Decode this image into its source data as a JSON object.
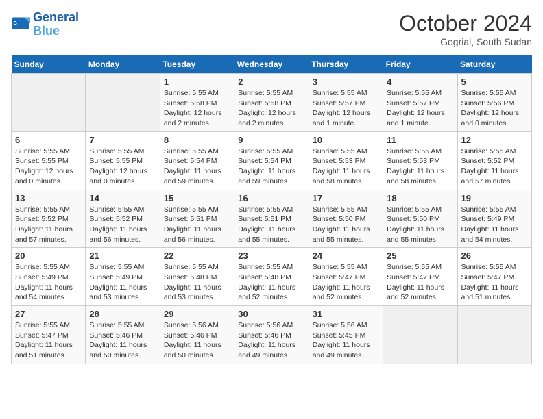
{
  "header": {
    "logo_general": "General",
    "logo_blue": "Blue",
    "month": "October 2024",
    "location": "Gogrial, South Sudan"
  },
  "days_of_week": [
    "Sunday",
    "Monday",
    "Tuesday",
    "Wednesday",
    "Thursday",
    "Friday",
    "Saturday"
  ],
  "weeks": [
    [
      {
        "day": "",
        "info": ""
      },
      {
        "day": "",
        "info": ""
      },
      {
        "day": "1",
        "info": "Sunrise: 5:55 AM\nSunset: 5:58 PM\nDaylight: 12 hours\nand 2 minutes."
      },
      {
        "day": "2",
        "info": "Sunrise: 5:55 AM\nSunset: 5:58 PM\nDaylight: 12 hours\nand 2 minutes."
      },
      {
        "day": "3",
        "info": "Sunrise: 5:55 AM\nSunset: 5:57 PM\nDaylight: 12 hours\nand 1 minute."
      },
      {
        "day": "4",
        "info": "Sunrise: 5:55 AM\nSunset: 5:57 PM\nDaylight: 12 hours\nand 1 minute."
      },
      {
        "day": "5",
        "info": "Sunrise: 5:55 AM\nSunset: 5:56 PM\nDaylight: 12 hours\nand 0 minutes."
      }
    ],
    [
      {
        "day": "6",
        "info": "Sunrise: 5:55 AM\nSunset: 5:55 PM\nDaylight: 12 hours\nand 0 minutes."
      },
      {
        "day": "7",
        "info": "Sunrise: 5:55 AM\nSunset: 5:55 PM\nDaylight: 12 hours\nand 0 minutes."
      },
      {
        "day": "8",
        "info": "Sunrise: 5:55 AM\nSunset: 5:54 PM\nDaylight: 11 hours\nand 59 minutes."
      },
      {
        "day": "9",
        "info": "Sunrise: 5:55 AM\nSunset: 5:54 PM\nDaylight: 11 hours\nand 59 minutes."
      },
      {
        "day": "10",
        "info": "Sunrise: 5:55 AM\nSunset: 5:53 PM\nDaylight: 11 hours\nand 58 minutes."
      },
      {
        "day": "11",
        "info": "Sunrise: 5:55 AM\nSunset: 5:53 PM\nDaylight: 11 hours\nand 58 minutes."
      },
      {
        "day": "12",
        "info": "Sunrise: 5:55 AM\nSunset: 5:52 PM\nDaylight: 11 hours\nand 57 minutes."
      }
    ],
    [
      {
        "day": "13",
        "info": "Sunrise: 5:55 AM\nSunset: 5:52 PM\nDaylight: 11 hours\nand 57 minutes."
      },
      {
        "day": "14",
        "info": "Sunrise: 5:55 AM\nSunset: 5:52 PM\nDaylight: 11 hours\nand 56 minutes."
      },
      {
        "day": "15",
        "info": "Sunrise: 5:55 AM\nSunset: 5:51 PM\nDaylight: 11 hours\nand 56 minutes."
      },
      {
        "day": "16",
        "info": "Sunrise: 5:55 AM\nSunset: 5:51 PM\nDaylight: 11 hours\nand 55 minutes."
      },
      {
        "day": "17",
        "info": "Sunrise: 5:55 AM\nSunset: 5:50 PM\nDaylight: 11 hours\nand 55 minutes."
      },
      {
        "day": "18",
        "info": "Sunrise: 5:55 AM\nSunset: 5:50 PM\nDaylight: 11 hours\nand 55 minutes."
      },
      {
        "day": "19",
        "info": "Sunrise: 5:55 AM\nSunset: 5:49 PM\nDaylight: 11 hours\nand 54 minutes."
      }
    ],
    [
      {
        "day": "20",
        "info": "Sunrise: 5:55 AM\nSunset: 5:49 PM\nDaylight: 11 hours\nand 54 minutes."
      },
      {
        "day": "21",
        "info": "Sunrise: 5:55 AM\nSunset: 5:49 PM\nDaylight: 11 hours\nand 53 minutes."
      },
      {
        "day": "22",
        "info": "Sunrise: 5:55 AM\nSunset: 5:48 PM\nDaylight: 11 hours\nand 53 minutes."
      },
      {
        "day": "23",
        "info": "Sunrise: 5:55 AM\nSunset: 5:48 PM\nDaylight: 11 hours\nand 52 minutes."
      },
      {
        "day": "24",
        "info": "Sunrise: 5:55 AM\nSunset: 5:47 PM\nDaylight: 11 hours\nand 52 minutes."
      },
      {
        "day": "25",
        "info": "Sunrise: 5:55 AM\nSunset: 5:47 PM\nDaylight: 11 hours\nand 52 minutes."
      },
      {
        "day": "26",
        "info": "Sunrise: 5:55 AM\nSunset: 5:47 PM\nDaylight: 11 hours\nand 51 minutes."
      }
    ],
    [
      {
        "day": "27",
        "info": "Sunrise: 5:55 AM\nSunset: 5:47 PM\nDaylight: 11 hours\nand 51 minutes."
      },
      {
        "day": "28",
        "info": "Sunrise: 5:55 AM\nSunset: 5:46 PM\nDaylight: 11 hours\nand 50 minutes."
      },
      {
        "day": "29",
        "info": "Sunrise: 5:56 AM\nSunset: 5:46 PM\nDaylight: 11 hours\nand 50 minutes."
      },
      {
        "day": "30",
        "info": "Sunrise: 5:56 AM\nSunset: 5:46 PM\nDaylight: 11 hours\nand 49 minutes."
      },
      {
        "day": "31",
        "info": "Sunrise: 5:56 AM\nSunset: 5:45 PM\nDaylight: 11 hours\nand 49 minutes."
      },
      {
        "day": "",
        "info": ""
      },
      {
        "day": "",
        "info": ""
      }
    ]
  ]
}
